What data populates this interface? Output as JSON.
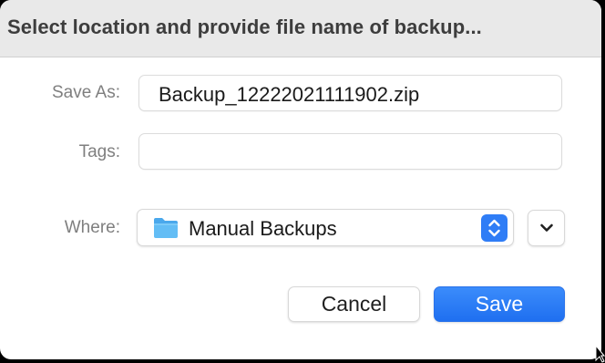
{
  "dialog": {
    "title": "Select location and provide file name of backup..."
  },
  "form": {
    "save_as_label": "Save As:",
    "save_as_value": "Backup_12222021111902.zip",
    "tags_label": "Tags:",
    "tags_value": "",
    "where_label": "Where:",
    "where_value": "Manual Backups"
  },
  "buttons": {
    "cancel_label": "Cancel",
    "save_label": "Save"
  },
  "colors": {
    "accent": "#2f7df6",
    "folder": "#5bb6f2",
    "titlebar": "#e9e9e9"
  },
  "icons": {
    "location_icon": "folder-icon",
    "popup_indicator": "up-down-chevron-icon",
    "expand_icon": "chevron-down-icon",
    "pointer": "cursor-arrow-icon"
  }
}
